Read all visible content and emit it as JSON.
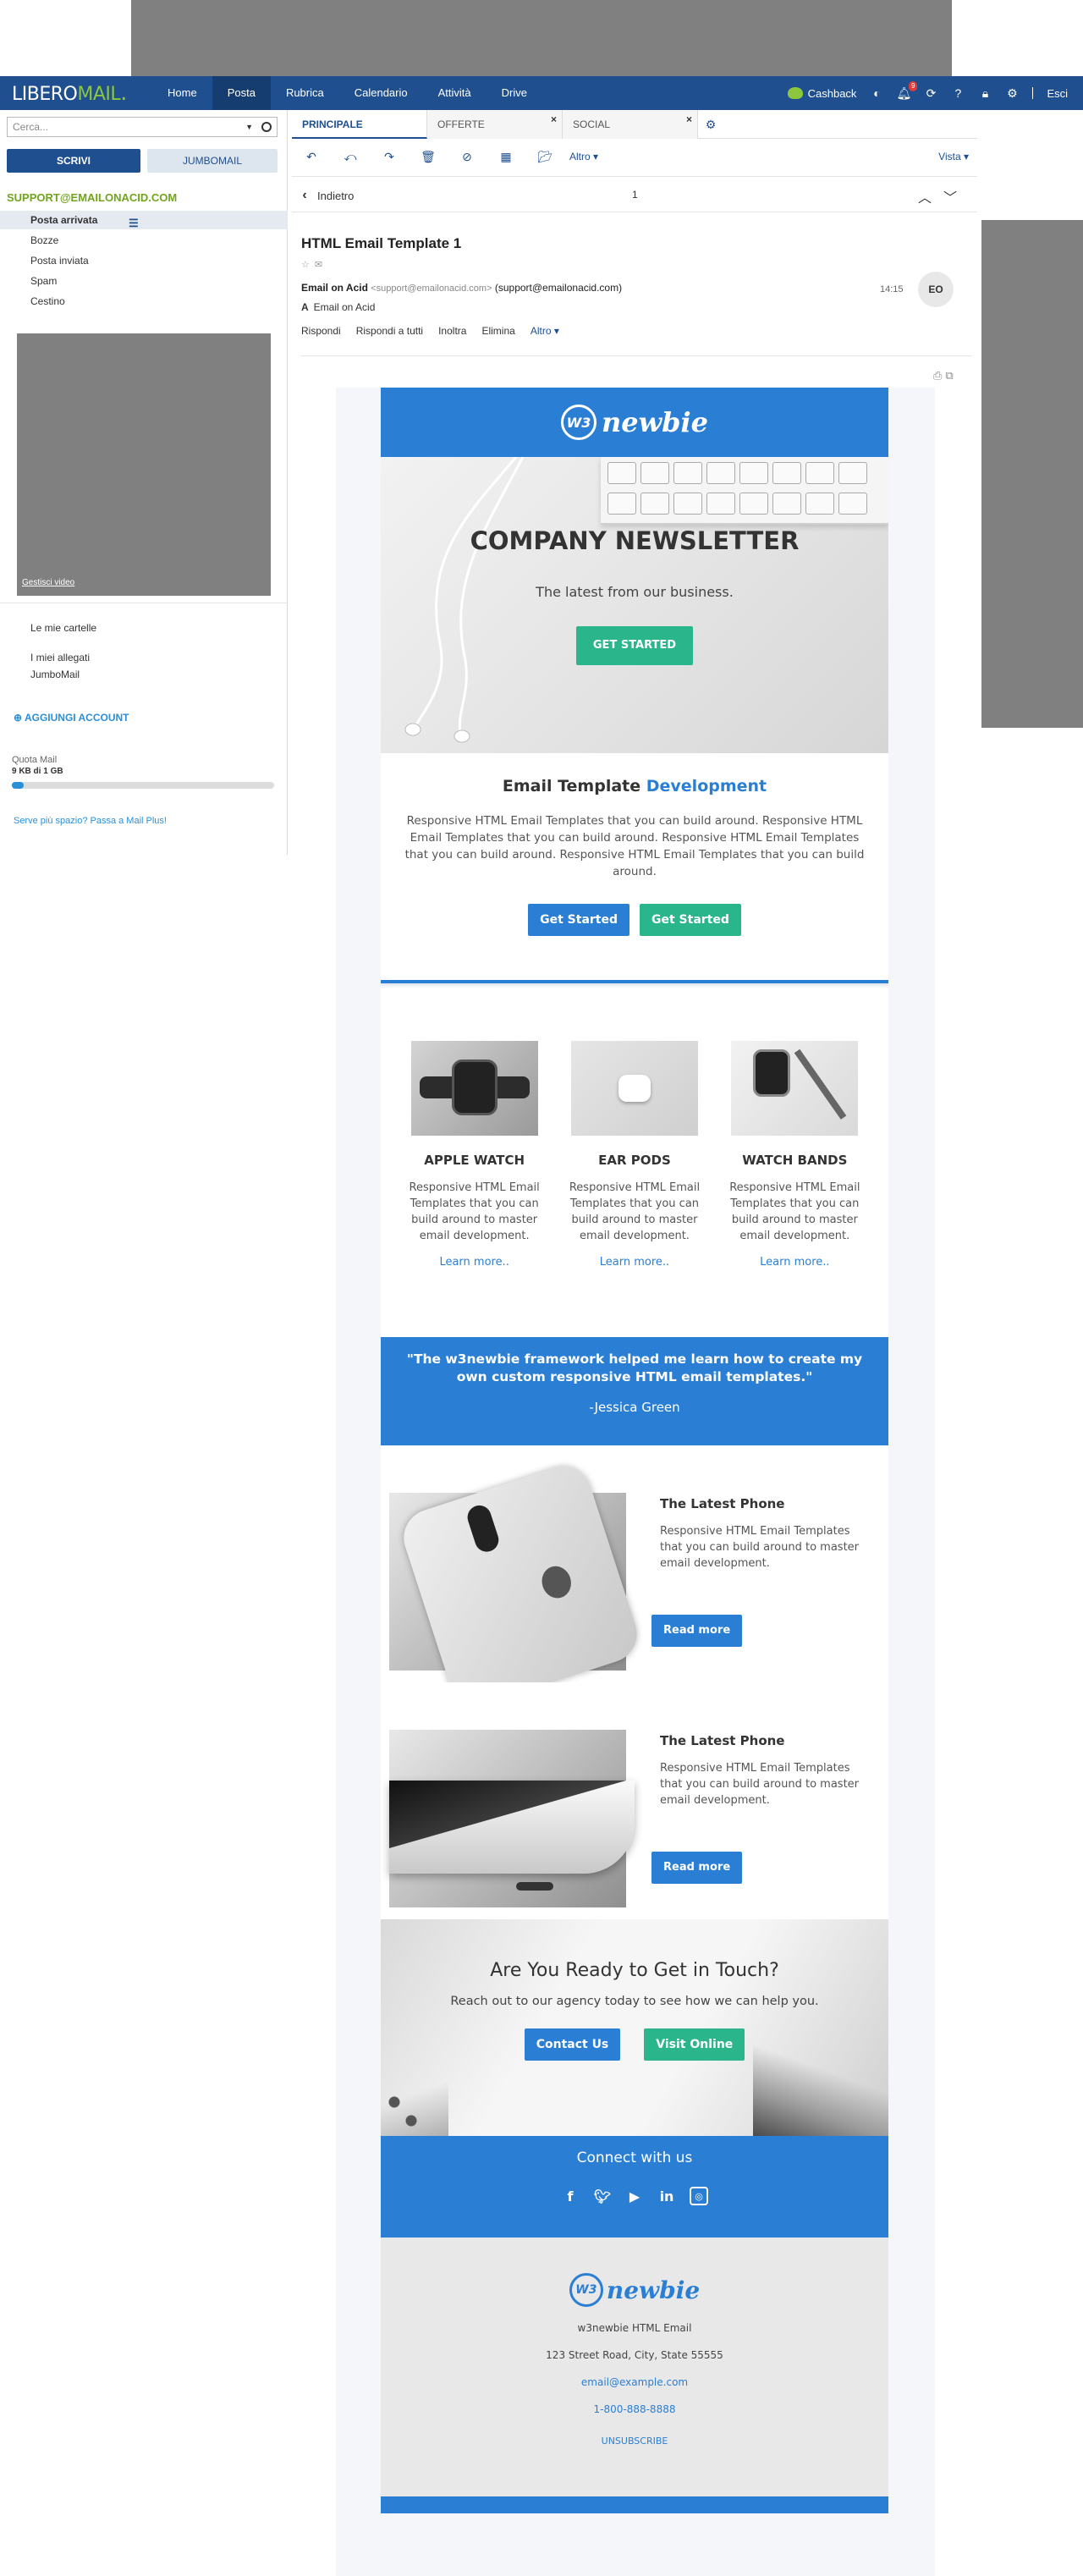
{
  "topnav": {
    "logo_libero": "LIBERO",
    "logo_mail": "MAIL",
    "items": [
      "Home",
      "Posta",
      "Rubrica",
      "Calendario",
      "Attività",
      "Drive"
    ],
    "active_item": "Posta",
    "cashback": "Cashback",
    "notification_count": "9",
    "logout": "Esci"
  },
  "sidebar": {
    "search_placeholder": "Cerca...",
    "compose": "SCRIVI",
    "jumbomail_button": "JUMBOMAIL",
    "account": "SUPPORT@EMAILONACID.COM",
    "folders": [
      "Posta arrivata",
      "Bozze",
      "Posta inviata",
      "Spam",
      "Cestino"
    ],
    "video_link": "Gestisci video",
    "my_folders": "Le mie cartelle",
    "my_attachments": "I miei allegati",
    "jumbomail": "JumboMail",
    "add_account": "AGGIUNGI ACCOUNT",
    "quota_label": "Quota Mail",
    "quota_value": "9 KB di 1 GB",
    "quota_fraction": 0.001,
    "upsell": "Serve più spazio? Passa a Mail Plus!"
  },
  "tabs": [
    {
      "label": "PRINCIPALE",
      "closable": false
    },
    {
      "label": "OFFERTE",
      "closable": true
    },
    {
      "label": "SOCIAL",
      "closable": true
    }
  ],
  "toolbar": {
    "icons": [
      "reply-icon",
      "reply-all-icon",
      "forward-icon",
      "delete-icon",
      "block-icon",
      "archive-icon",
      "move-folder-icon"
    ],
    "more": "Altro",
    "view": "Vista"
  },
  "message_nav": {
    "back": "Indietro",
    "position": "1"
  },
  "message": {
    "subject": "HTML Email Template 1",
    "sender_name": "Email on Acid",
    "sender_address": "<support@emailonacid.com>",
    "reply_to": "(support@emailonacid.com)",
    "to_label": "A",
    "to": "Email on Acid",
    "time": "14:15",
    "avatar_initials": "EO",
    "actions": [
      "Rispondi",
      "Rispondi a tutti",
      "Inoltra",
      "Elimina"
    ],
    "actions_more": "Altro"
  },
  "email": {
    "brand_mark": "W3",
    "brand_name": "newbie",
    "hero": {
      "title": "COMPANY NEWSLETTER",
      "subtitle": "The latest from our business.",
      "button": "GET STARTED"
    },
    "intro": {
      "title_prefix": "Email Template",
      "title_highlight": "Development",
      "body": "Responsive HTML Email Templates that you can build around. Responsive HTML Email Templates that you can build around. Responsive HTML Email Templates that you can build around. Responsive HTML Email Templates that you can build around.",
      "button_primary": "Get Started",
      "button_secondary": "Get Started"
    },
    "products": [
      {
        "title": "APPLE WATCH",
        "body": "Responsive HTML Email Templates that you can build around to master email development.",
        "link": "Learn more.."
      },
      {
        "title": "EAR PODS",
        "body": "Responsive HTML Email Templates that you can build around to master email development.",
        "link": "Learn more.."
      },
      {
        "title": "WATCH BANDS",
        "body": "Responsive HTML Email Templates that you can build around to master email development.",
        "link": "Learn more.."
      }
    ],
    "testimonial": {
      "quote": "\"The w3newbie framework helped me learn how to create my own custom responsive HTML email templates.\"",
      "author": "-Jessica Green"
    },
    "features": [
      {
        "title": "The Latest Phone",
        "body": "Responsive HTML Email Templates that you can build around to master email development.",
        "button": "Read more"
      },
      {
        "title": "The Latest Phone",
        "body": "Responsive HTML Email Templates that you can build around to master email development.",
        "button": "Read more"
      }
    ],
    "cta": {
      "title": "Are You Ready to Get in Touch?",
      "body": "Reach out to our agency today to see how we can help you.",
      "button_contact": "Contact Us",
      "button_visit": "Visit Online"
    },
    "connect": {
      "title": "Connect with us",
      "icons": [
        "facebook-icon",
        "twitter-icon",
        "youtube-icon",
        "linkedin-icon",
        "instagram-icon"
      ]
    },
    "footer": {
      "company": "w3newbie HTML Email",
      "address": "123 Street Road, City, State 55555",
      "email": "email@example.com",
      "phone": "1-800-888-8888",
      "unsubscribe": "UNSUBSCRIBE"
    }
  },
  "colors": {
    "nav_bg": "#1f4f8f",
    "libero_green": "#8cc63f",
    "email_blue": "#2a7fd4",
    "email_green": "#2bb58b"
  }
}
